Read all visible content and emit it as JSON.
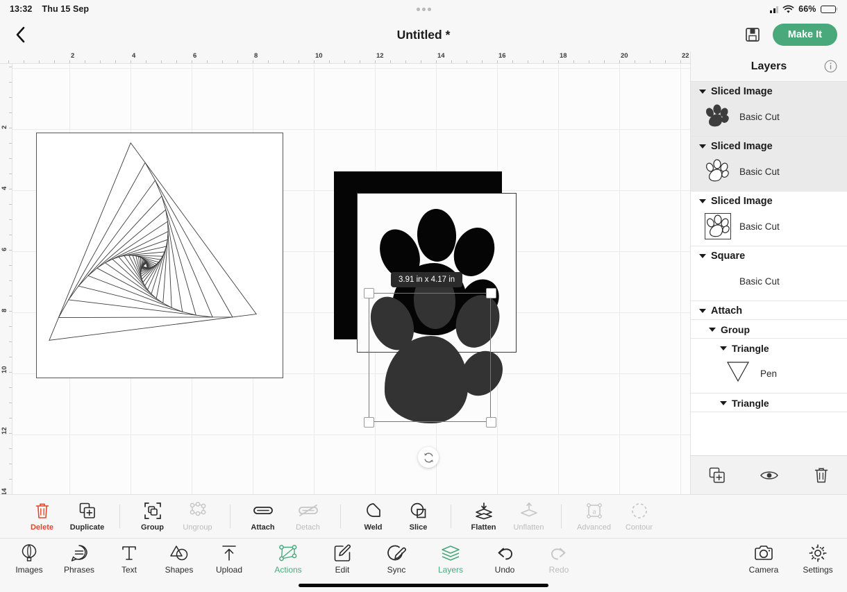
{
  "status_bar": {
    "time": "13:32",
    "date": "Thu 15 Sep",
    "battery_percent": "66%",
    "battery_level": 66,
    "wifi_icon": "wifi-icon",
    "cellular_icon": "cellular-signal-icon"
  },
  "header": {
    "back_icon": "chevron-left-icon",
    "title": "Untitled *",
    "save_icon": "save-floppy-icon",
    "make_it_label": "Make It",
    "accent_color": "#4aa97b"
  },
  "canvas": {
    "ruler_h_labels": [
      "2",
      "4",
      "6",
      "8",
      "10",
      "12",
      "14",
      "16",
      "18",
      "20",
      "22"
    ],
    "ruler_v_labels": [
      "2",
      "4",
      "6",
      "8",
      "10",
      "12",
      "14"
    ],
    "selection": {
      "size_label": "3.91 in x 4.17 in",
      "rotate_icon": "rotate-icon"
    },
    "objects": [
      {
        "name": "spirograph-triangle-square",
        "type": "outline-square"
      },
      {
        "name": "black-square",
        "type": "filled-square",
        "color": "#050505"
      },
      {
        "name": "white-square-paw",
        "type": "filled-square",
        "color": "#fcfcfc"
      },
      {
        "name": "selected-paw",
        "type": "paw",
        "color": "#333333"
      }
    ]
  },
  "layers_panel": {
    "title": "Layers",
    "info_icon": "info-icon",
    "groups": [
      {
        "name": "Sliced Image",
        "selected": true,
        "indent": 0,
        "child": {
          "label": "Basic Cut",
          "thumb": "paw-solid-icon",
          "framed": false
        }
      },
      {
        "name": "Sliced Image",
        "selected": true,
        "indent": 0,
        "child": {
          "label": "Basic Cut",
          "thumb": "paw-outline-icon",
          "framed": false
        }
      },
      {
        "name": "Sliced Image",
        "selected": false,
        "indent": 0,
        "child": {
          "label": "Basic Cut",
          "thumb": "paw-outline-icon",
          "framed": true
        }
      },
      {
        "name": "Square",
        "selected": false,
        "indent": 0,
        "child": {
          "label": "Basic Cut",
          "thumb": "black-square-swatch",
          "framed": false
        }
      },
      {
        "name": "Attach",
        "selected": false,
        "indent": 0,
        "child": null
      },
      {
        "name": "Group",
        "selected": false,
        "indent": 1,
        "child": null
      },
      {
        "name": "Triangle",
        "selected": false,
        "indent": 2,
        "child": {
          "label": "Pen",
          "thumb": "triangle-outline-icon",
          "framed": false
        }
      },
      {
        "name": "Triangle",
        "selected": false,
        "indent": 2,
        "child": null
      }
    ],
    "footer": [
      {
        "name": "duplicate-layer-button",
        "icon": "duplicate-icon"
      },
      {
        "name": "visibility-toggle-button",
        "icon": "eye-icon"
      },
      {
        "name": "delete-layer-button",
        "icon": "trash-icon"
      }
    ]
  },
  "edit_toolbar": [
    {
      "label": "Delete",
      "icon": "trash-icon",
      "state": "danger"
    },
    {
      "label": "Duplicate",
      "icon": "duplicate-icon",
      "state": "on"
    },
    {
      "label": "Group",
      "icon": "group-icon",
      "state": "on"
    },
    {
      "label": "Ungroup",
      "icon": "ungroup-icon",
      "state": "off"
    },
    {
      "label": "Attach",
      "icon": "attach-icon",
      "state": "on"
    },
    {
      "label": "Detach",
      "icon": "detach-icon",
      "state": "off"
    },
    {
      "label": "Weld",
      "icon": "weld-icon",
      "state": "on"
    },
    {
      "label": "Slice",
      "icon": "slice-icon",
      "state": "on"
    },
    {
      "label": "Flatten",
      "icon": "flatten-icon",
      "state": "on"
    },
    {
      "label": "Unflatten",
      "icon": "unflatten-icon",
      "state": "off"
    },
    {
      "label": "Advanced",
      "icon": "advanced-icon",
      "state": "off"
    },
    {
      "label": "Contour",
      "icon": "contour-icon",
      "state": "off"
    }
  ],
  "bottom_nav": {
    "left": [
      {
        "label": "Images",
        "icon": "balloon-icon"
      },
      {
        "label": "Phrases",
        "icon": "speech-bubble-icon"
      },
      {
        "label": "Text",
        "icon": "text-t-icon"
      },
      {
        "label": "Shapes",
        "icon": "shapes-icon"
      },
      {
        "label": "Upload",
        "icon": "upload-icon"
      }
    ],
    "center": [
      {
        "label": "Actions",
        "icon": "actions-nodes-icon",
        "state": "active"
      },
      {
        "label": "Edit",
        "icon": "edit-pencil-icon",
        "state": "on"
      },
      {
        "label": "Sync",
        "icon": "sync-pen-icon",
        "state": "on"
      },
      {
        "label": "Layers",
        "icon": "layers-stack-icon",
        "state": "active"
      },
      {
        "label": "Undo",
        "icon": "undo-arrow-icon",
        "state": "on"
      },
      {
        "label": "Redo",
        "icon": "redo-arrow-icon",
        "state": "off"
      }
    ],
    "right": [
      {
        "label": "Camera",
        "icon": "camera-icon"
      },
      {
        "label": "Settings",
        "icon": "gear-icon"
      }
    ]
  }
}
